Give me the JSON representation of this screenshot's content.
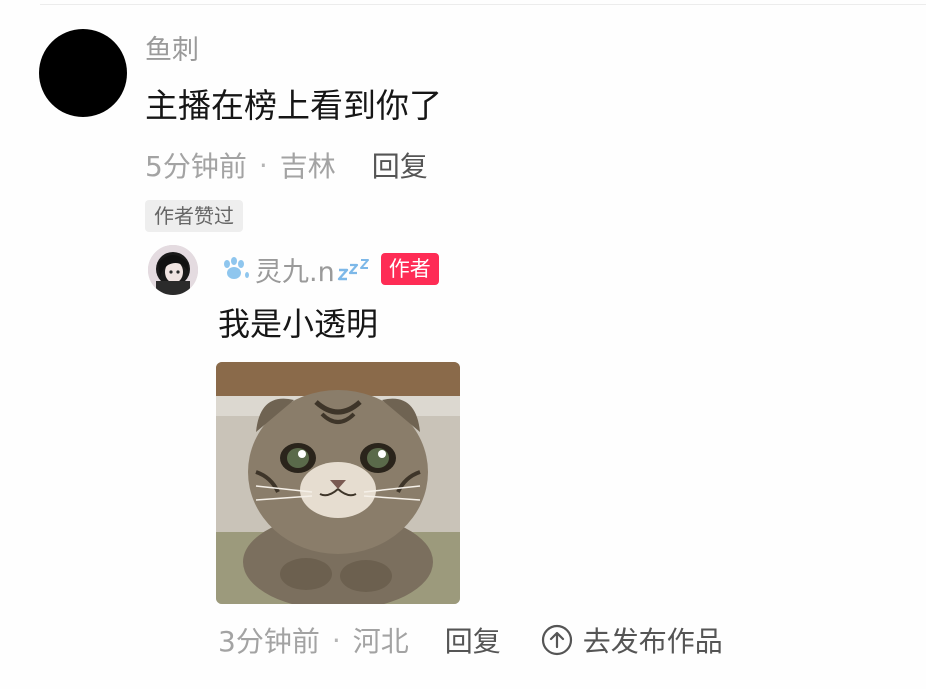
{
  "comment": {
    "username": "鱼刺",
    "text": "主播在榜上看到你了",
    "time": "5分钟前",
    "separator": "·",
    "location": "吉林",
    "reply_label": "回复",
    "liked_badge": "作者赞过"
  },
  "reply": {
    "username": "灵九.n",
    "author_badge": "作者",
    "text": "我是小透明",
    "time": "3分钟前",
    "separator": "·",
    "location": "河北",
    "reply_label": "回复",
    "publish_label": "去发布作品",
    "image_subject": "cat"
  },
  "colors": {
    "author_badge": "#fe2c55",
    "meta_text": "#a3a3a3",
    "action_text": "#555555"
  },
  "icons": {
    "paw": "paw-icon",
    "zzz": "zzz-icon",
    "upload": "upload-arrow-icon"
  }
}
